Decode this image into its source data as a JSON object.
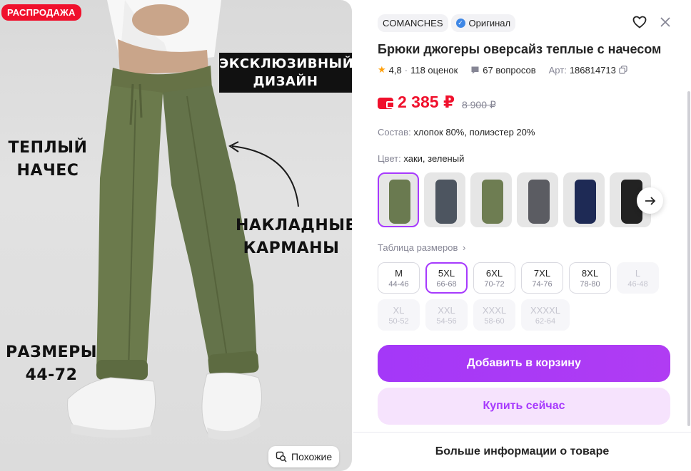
{
  "photo": {
    "sale_badge": "РАСПРОДАЖА",
    "overlay_exclusive_line1": "ЭКСКЛЮЗИВНЫЙ",
    "overlay_exclusive_line2": "ДИЗАЙН",
    "overlay_warm_line1": "ТЕПЛЫЙ",
    "overlay_warm_line2": "НАЧЕС",
    "overlay_pockets_line1": "НАКЛАДНЫЕ",
    "overlay_pockets_line2": "КАРМАНЫ",
    "overlay_sizes_line1": "РАЗМЕРЫ",
    "overlay_sizes_line2": "44-72",
    "similar_label": "Похожие"
  },
  "header": {
    "brand": "COMANCHES",
    "original_label": "Оригинал",
    "icons": [
      "heart-icon",
      "close-icon"
    ]
  },
  "product": {
    "title": "Брюки джогеры оверсайз теплые с начесом",
    "rating": "4,8",
    "reviews": "118 оценок",
    "questions": "67 вопросов",
    "article_label": "Арт:",
    "article": "186814713",
    "price": "2 385 ₽",
    "old_price": "8 900 ₽",
    "composition_label": "Состав:",
    "composition": "хлопок 80%, полиэстер 20%",
    "color_label": "Цвет:",
    "color": "хаки, зеленый",
    "size_table_link": "Таблица размеров",
    "thumb_colors": [
      "#6a7a50",
      "#4d5560",
      "#6e7d52",
      "#5b5c62",
      "#1e2a55",
      "#222222"
    ],
    "sizes": [
      {
        "label": "M",
        "range": "44-46",
        "state": "available"
      },
      {
        "label": "5XL",
        "range": "66-68",
        "state": "selected"
      },
      {
        "label": "6XL",
        "range": "70-72",
        "state": "available"
      },
      {
        "label": "7XL",
        "range": "74-76",
        "state": "available"
      },
      {
        "label": "8XL",
        "range": "78-80",
        "state": "available"
      },
      {
        "label": "L",
        "range": "46-48",
        "state": "disabled"
      },
      {
        "label": "XL",
        "range": "50-52",
        "state": "disabled"
      },
      {
        "label": "XXL",
        "range": "54-56",
        "state": "disabled"
      },
      {
        "label": "XXXL",
        "range": "58-60",
        "state": "disabled"
      },
      {
        "label": "XXXXL",
        "range": "62-64",
        "state": "disabled"
      }
    ]
  },
  "actions": {
    "add_to_cart": "Добавить в корзину",
    "buy_now": "Купить сейчас",
    "more_info": "Больше информации о товаре"
  },
  "colors": {
    "accent": "#a73afd",
    "price": "#f0102c",
    "sale_badge": "#f0102c"
  }
}
